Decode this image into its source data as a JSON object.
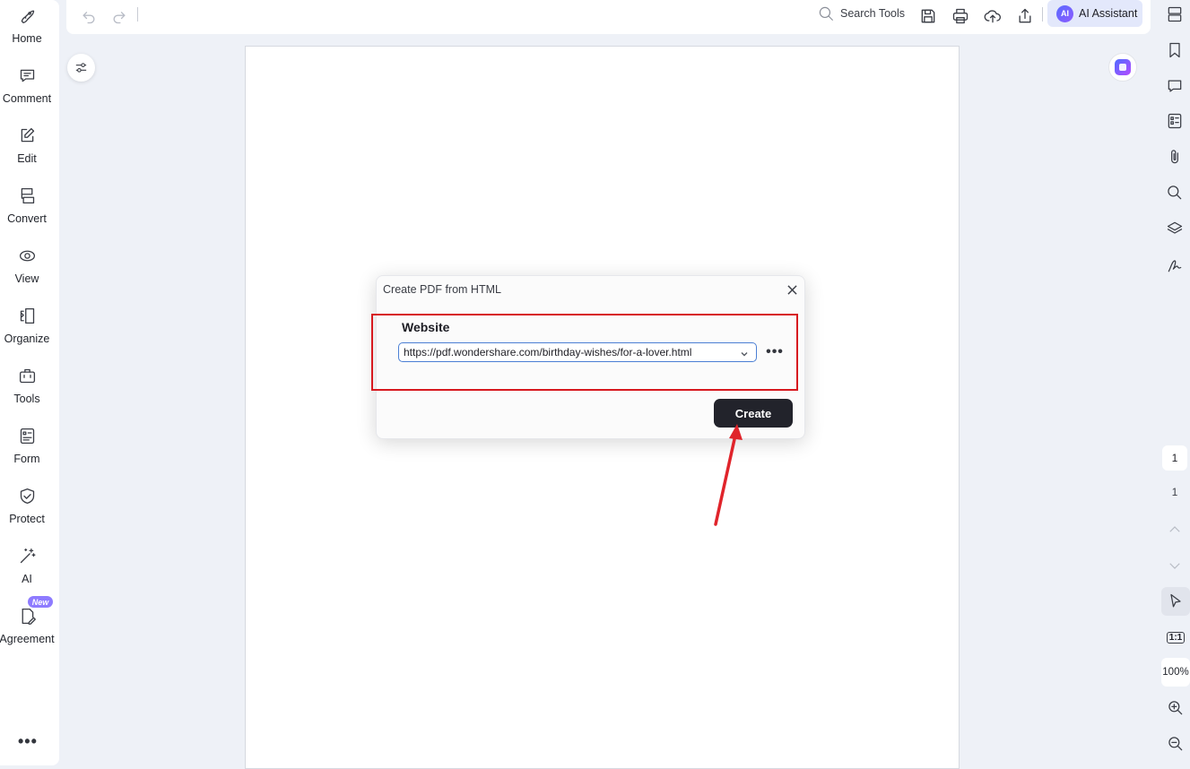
{
  "left_sidebar": {
    "items": [
      {
        "label": "Home",
        "icon": "rocket-icon"
      },
      {
        "label": "Comment",
        "icon": "comment-icon"
      },
      {
        "label": "Edit",
        "icon": "edit-icon"
      },
      {
        "label": "Convert",
        "icon": "convert-icon"
      },
      {
        "label": "View",
        "icon": "view-icon"
      },
      {
        "label": "Organize",
        "icon": "organize-icon"
      },
      {
        "label": "Tools",
        "icon": "tools-icon"
      },
      {
        "label": "Form",
        "icon": "form-icon"
      },
      {
        "label": "Protect",
        "icon": "protect-icon"
      },
      {
        "label": "AI",
        "icon": "ai-wand-icon"
      },
      {
        "label": "Agreement",
        "icon": "agreement-icon"
      }
    ],
    "new_badge": "New",
    "more_label": "•••"
  },
  "toolbar": {
    "search_label": "Search Tools",
    "ai_logo": "AI",
    "ai_assistant_label": "AI Assistant"
  },
  "right_sidebar": {
    "page_current": "1",
    "page_total": "1",
    "fit_label": "1:1",
    "zoom_level": "100%"
  },
  "dialog": {
    "title": "Create PDF from HTML",
    "website_label": "Website",
    "url_value": "https://pdf.wondershare.com/birthday-wishes/for-a-lover.html",
    "more_label": "•••",
    "create_label": "Create"
  },
  "colors": {
    "highlight": "#d7191f",
    "create_button": "#22232b",
    "ai_assistant_bg": "#e3e8fb",
    "accent": "#4b7fd4"
  }
}
